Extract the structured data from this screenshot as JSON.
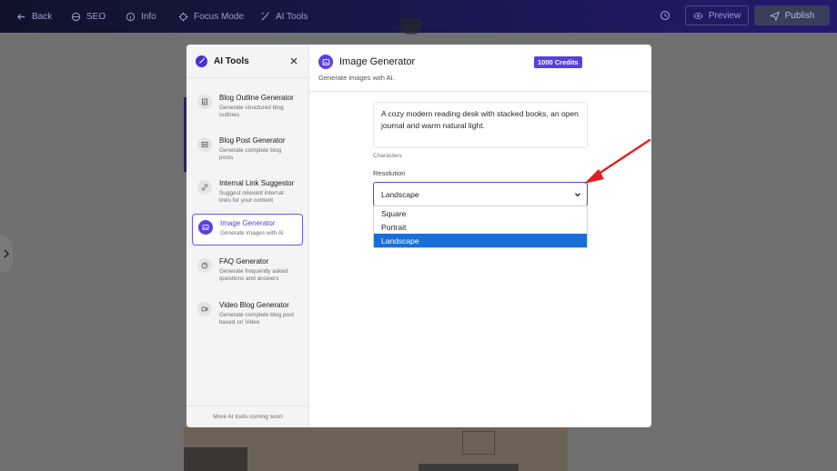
{
  "topbar": {
    "back": "Back",
    "seo": "SEO",
    "info": "Info",
    "focus": "Focus Mode",
    "ai_tools": "AI Tools",
    "preview": "Preview",
    "publish": "Publish"
  },
  "sidebar": {
    "title": "AI Tools",
    "footer": "More AI tools coming soon",
    "items": [
      {
        "name": "Blog Outline Generator",
        "desc": "Generate structured blog outlines",
        "icon": "document-icon"
      },
      {
        "name": "Blog Post Generator",
        "desc": "Generate complete blog posts",
        "icon": "post-icon"
      },
      {
        "name": "Internal Link Suggestor",
        "desc": "Suggest relevant internal links for your content",
        "icon": "link-icon"
      },
      {
        "name": "Image Generator",
        "desc": "Generate images with AI",
        "icon": "image-icon"
      },
      {
        "name": "FAQ Generator",
        "desc": "Generate frequently asked questions and answers",
        "icon": "question-icon"
      },
      {
        "name": "Video Blog Generator",
        "desc": "Generate complete blog post based on Video",
        "icon": "video-icon"
      }
    ]
  },
  "main": {
    "title": "Image Generator",
    "badge": "1000 Credits",
    "subtitle": "Generate images with AI.",
    "prompt": "A cozy modern reading desk with stacked books, an open journal and warm natural light.",
    "characters_label": "Characters",
    "resolution_label": "Resolution",
    "resolution_value": "Landscape",
    "options": [
      "Square",
      "Portrait",
      "Landscape"
    ],
    "selected_option": "Landscape"
  },
  "colors": {
    "accent": "#5b3fe0",
    "selected_option": "#1a6fd6",
    "annotation_arrow": "#e02020"
  }
}
